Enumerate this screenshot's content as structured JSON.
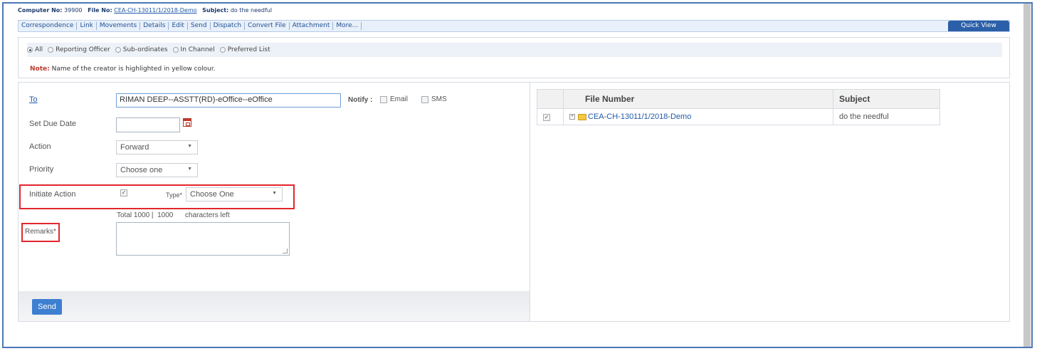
{
  "infobar": {
    "computer_label": "Computer No:",
    "computer_no": "39900",
    "file_label": "File No:",
    "file_no": "CEA-CH-13011/1/2018-Demo",
    "subject_label": "Subject:",
    "subject": "do the needful"
  },
  "tabs": [
    "Correspondence",
    "Link",
    "Movements",
    "Details",
    "Edit",
    "Send",
    "Dispatch",
    "Convert File",
    "Attachment",
    "More..."
  ],
  "quick_view": "Quick View",
  "filters": {
    "options": [
      "All",
      "Reporting Officer",
      "Sub-ordinates",
      "In Channel",
      "Preferred List"
    ],
    "selected": "All"
  },
  "note": {
    "label": "Note:",
    "text": "Name of the creator is highlighted in yellow colour."
  },
  "form": {
    "to_label": "To",
    "to_value": "RIMAN DEEP--ASSTT(RD)-eOffice--eOffice",
    "notify_label": "Notify :",
    "email_label": "Email",
    "sms_label": "SMS",
    "due_date_label": "Set Due Date",
    "due_date_value": "",
    "action_label": "Action",
    "action_value": "Forward",
    "priority_label": "Priority",
    "priority_value": "Choose one",
    "initiate_label": "Initiate Action",
    "type_label": "Type*",
    "type_value": "Choose One",
    "char_total": "Total 1000 |",
    "char_left_count": "1000",
    "char_left_label": "characters left",
    "remarks_label": "Remarks*",
    "remarks_value": "",
    "send_label": "Send"
  },
  "grid": {
    "headers": [
      "File Number",
      "Subject"
    ],
    "rows": [
      {
        "file_number": "CEA-CH-13011/1/2018-Demo",
        "subject": "do the needful",
        "checked": true
      }
    ]
  },
  "colors": {
    "accent": "#2b5fa8",
    "highlight_box": "#e3262d",
    "send_button": "#3d7fd1"
  }
}
